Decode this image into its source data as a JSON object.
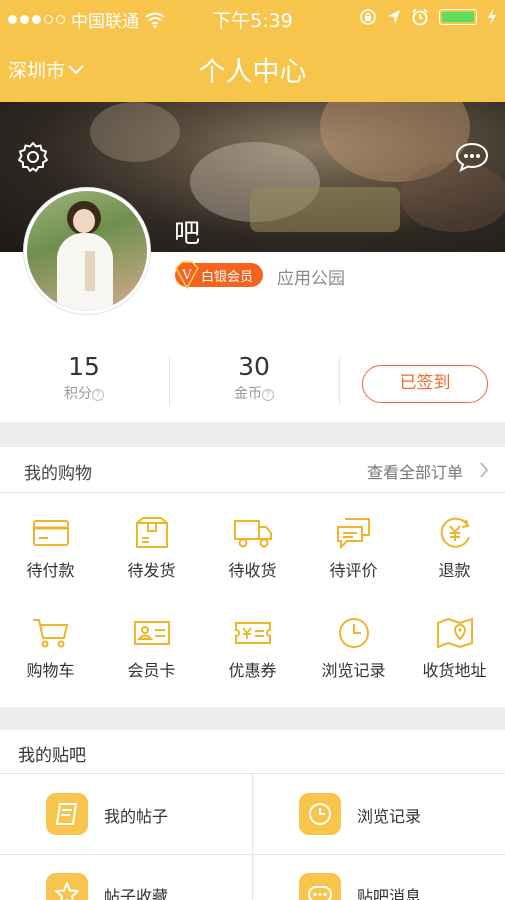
{
  "status_bar": {
    "carrier": "中国联通",
    "time": "下午5:39"
  },
  "nav": {
    "city": "深圳市",
    "title": "个人中心"
  },
  "profile": {
    "name": "吧",
    "member_level": "白银会员",
    "member_badge_letter": "V",
    "tag": "应用公园"
  },
  "stats": {
    "points": {
      "value": "15",
      "label": "积分"
    },
    "coins": {
      "value": "30",
      "label": "金币"
    },
    "help_glyph": "?",
    "checkin_label": "已签到"
  },
  "shopping": {
    "title": "我的购物",
    "view_all": "查看全部订单",
    "items": [
      {
        "label": "待付款",
        "icon": "card-icon"
      },
      {
        "label": "待发货",
        "icon": "package-icon"
      },
      {
        "label": "待收货",
        "icon": "truck-icon"
      },
      {
        "label": "待评价",
        "icon": "comment-icon"
      },
      {
        "label": "退款",
        "icon": "yen-refund-icon"
      },
      {
        "label": "购物车",
        "icon": "cart-icon"
      },
      {
        "label": "会员卡",
        "icon": "member-card-icon"
      },
      {
        "label": "优惠券",
        "icon": "coupon-icon"
      },
      {
        "label": "浏览记录",
        "icon": "clock-icon"
      },
      {
        "label": "收货地址",
        "icon": "map-pin-icon"
      }
    ]
  },
  "tieba": {
    "title": "我的贴吧",
    "items": [
      {
        "label": "我的帖子",
        "icon": "post-icon"
      },
      {
        "label": "浏览记录",
        "icon": "clock-icon"
      },
      {
        "label": "帖子收藏",
        "icon": "star-icon"
      },
      {
        "label": "贴吧消息",
        "icon": "message-icon"
      }
    ]
  },
  "colors": {
    "brand": "#f7c44c",
    "accent": "#f06a2a",
    "badge": "#f5641e",
    "battery": "#5ce05c"
  }
}
